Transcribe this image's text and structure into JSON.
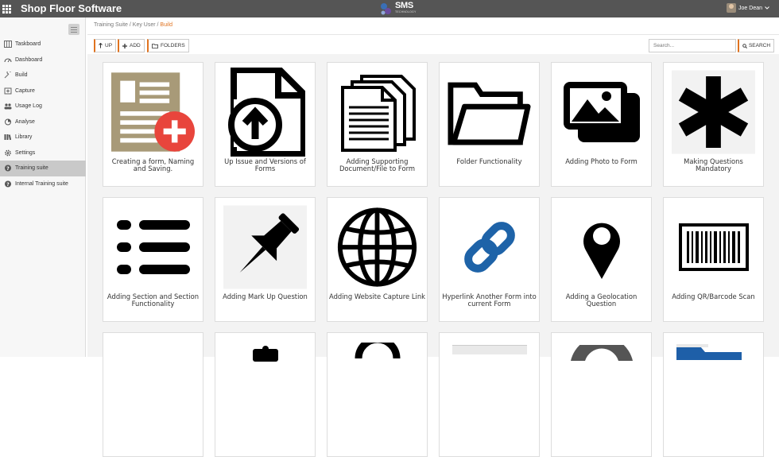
{
  "topbar": {
    "app_title": "Shop Floor Software",
    "logo_text": "SMS",
    "logo_sub": "TECHNOLOGY",
    "user_name": "Joe Dean",
    "user_menu_icon": "chevron-down-icon"
  },
  "sidebar": {
    "items": [
      {
        "label": "Taskboard",
        "icon": "taskboard-icon"
      },
      {
        "label": "Dashboard",
        "icon": "dashboard-icon"
      },
      {
        "label": "Build",
        "icon": "wrench-icon"
      },
      {
        "label": "Capture",
        "icon": "capture-icon"
      },
      {
        "label": "Usage Log",
        "icon": "users-icon"
      },
      {
        "label": "Analyse",
        "icon": "analyse-icon"
      },
      {
        "label": "Library",
        "icon": "library-icon"
      },
      {
        "label": "Settings",
        "icon": "gear-icon"
      },
      {
        "label": "Training suite",
        "icon": "question-icon",
        "active": true
      },
      {
        "label": "Internal Training suite",
        "icon": "question-icon"
      }
    ]
  },
  "breadcrumb": {
    "part1": "Training Suite",
    "sep": " / ",
    "part2": "Key User",
    "current": "Build"
  },
  "toolbar": {
    "up_label": "UP",
    "add_label": "ADD",
    "folders_label": "FOLDERS",
    "search_placeholder": "Search...",
    "search_label": "SEARCH"
  },
  "cards": [
    {
      "label": "Creating a form, Naming and Saving.",
      "icon": "form-add-icon"
    },
    {
      "label": "Up Issue and Versions of Forms",
      "icon": "file-upload-icon"
    },
    {
      "label": "Adding Supporting Document/File to Form",
      "icon": "documents-icon"
    },
    {
      "label": "Folder Functionality",
      "icon": "folder-icon"
    },
    {
      "label": "Adding Photo to Form",
      "icon": "photos-icon"
    },
    {
      "label": "Making Questions Mandatory",
      "icon": "asterisk-icon"
    },
    {
      "label": "Adding Section and Section Functionality",
      "icon": "list-icon"
    },
    {
      "label": "Adding Mark Up Question",
      "icon": "pushpin-icon"
    },
    {
      "label": "Adding Website Capture Link",
      "icon": "globe-icon"
    },
    {
      "label": "Hyperlink Another Form into current Form",
      "icon": "link-icon"
    },
    {
      "label": "Adding a Geolocation Question",
      "icon": "map-pin-icon"
    },
    {
      "label": "Adding QR/Barcode Scan",
      "icon": "barcode-icon"
    }
  ]
}
